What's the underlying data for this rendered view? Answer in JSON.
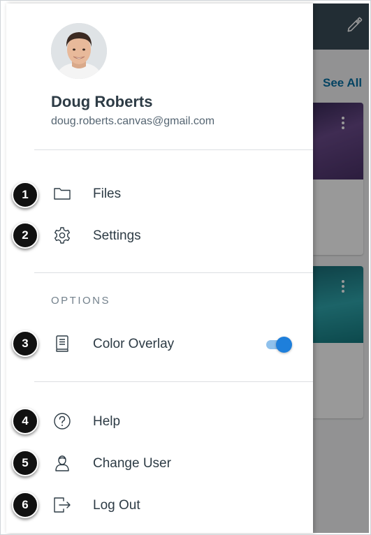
{
  "user": {
    "name": "Doug Roberts",
    "email": "doug.roberts.canvas@gmail.com"
  },
  "menu": {
    "files": {
      "label": "Files",
      "icon": "folder-icon"
    },
    "settings": {
      "label": "Settings",
      "icon": "gear-icon"
    },
    "help": {
      "label": "Help",
      "icon": "question-circle-icon"
    },
    "change_user": {
      "label": "Change User",
      "icon": "user-icon"
    },
    "log_out": {
      "label": "Log Out",
      "icon": "log-out-icon"
    }
  },
  "options": {
    "title": "OPTIONS",
    "color_overlay": {
      "label": "Color Overlay",
      "icon": "book-icon",
      "enabled": true
    }
  },
  "background": {
    "see_all": "See All"
  },
  "callouts": [
    "1",
    "2",
    "3",
    "4",
    "5",
    "6"
  ],
  "colors": {
    "toggle_on": "#1e7fdb",
    "text_primary": "#2d3b45",
    "link": "#0770a3"
  }
}
